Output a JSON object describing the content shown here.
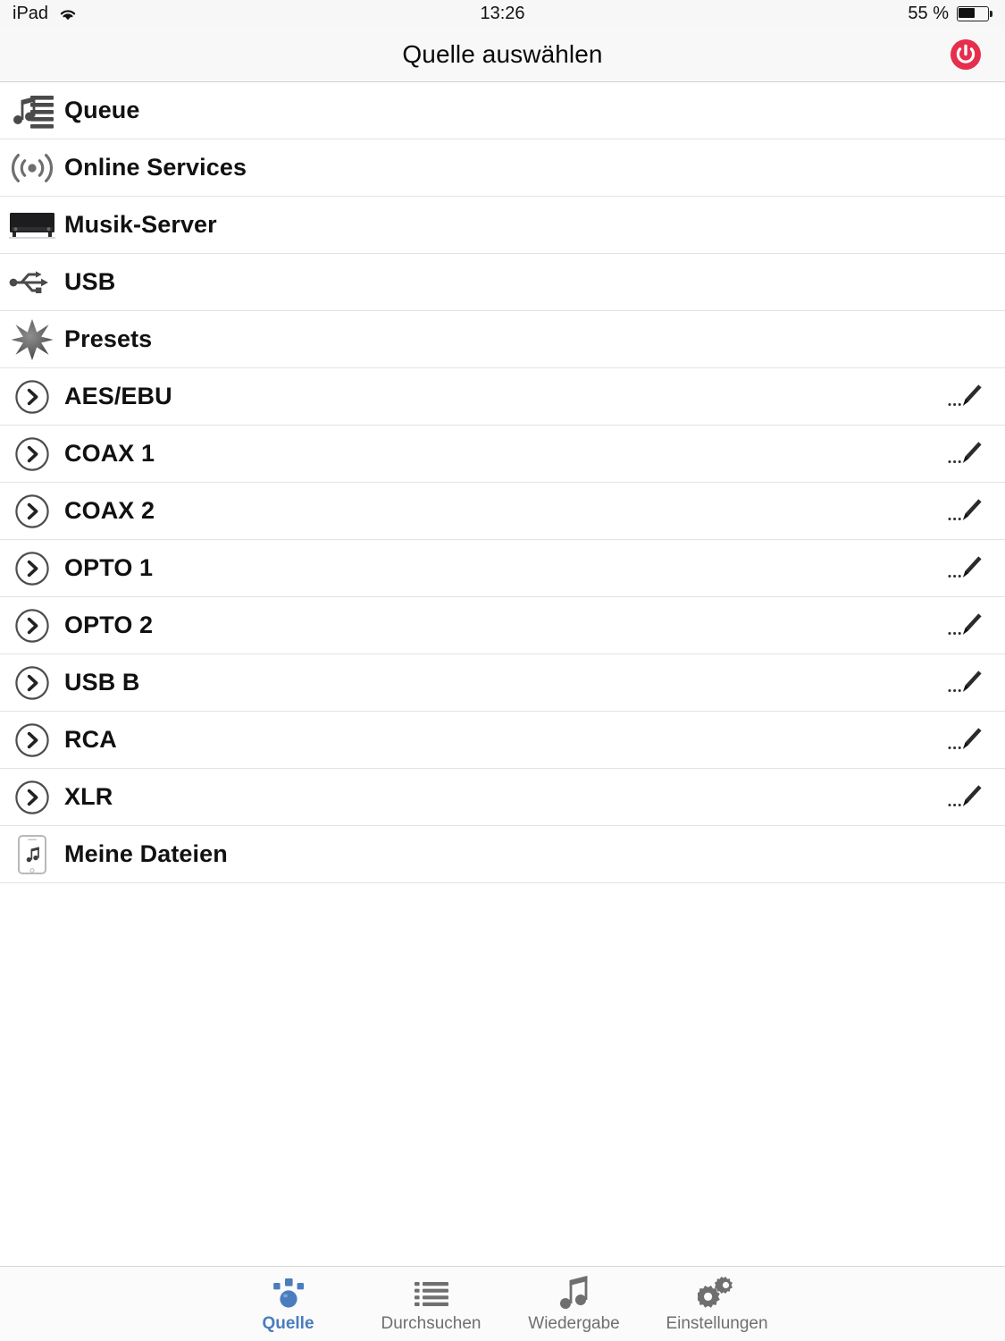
{
  "status_bar": {
    "device": "iPad",
    "wifi_icon": "wifi-icon",
    "time": "13:26",
    "battery_percent": "55 %",
    "battery_level": 55
  },
  "nav": {
    "title": "Quelle auswählen",
    "power_icon": "power-icon",
    "power_color": "#E62E4D"
  },
  "list": {
    "rows": [
      {
        "label": "Queue",
        "icon": "queue-music-list-icon",
        "editable": false
      },
      {
        "label": "Online Services",
        "icon": "broadcast-signal-icon",
        "editable": false
      },
      {
        "label": "Musik-Server",
        "icon": "av-component-icon",
        "editable": false
      },
      {
        "label": "USB",
        "icon": "usb-icon",
        "editable": false
      },
      {
        "label": "Presets",
        "icon": "star-burst-icon",
        "editable": false
      },
      {
        "label": "AES/EBU",
        "icon": "chevron-right-circle-icon",
        "editable": true,
        "edit_icon": "pencil-edit-icon"
      },
      {
        "label": "COAX 1",
        "icon": "chevron-right-circle-icon",
        "editable": true,
        "edit_icon": "pencil-edit-icon"
      },
      {
        "label": "COAX 2",
        "icon": "chevron-right-circle-icon",
        "editable": true,
        "edit_icon": "pencil-edit-icon"
      },
      {
        "label": "OPTO 1",
        "icon": "chevron-right-circle-icon",
        "editable": true,
        "edit_icon": "pencil-edit-icon"
      },
      {
        "label": "OPTO 2",
        "icon": "chevron-right-circle-icon",
        "editable": true,
        "edit_icon": "pencil-edit-icon"
      },
      {
        "label": "USB B",
        "icon": "chevron-right-circle-icon",
        "editable": true,
        "edit_icon": "pencil-edit-icon"
      },
      {
        "label": "RCA",
        "icon": "chevron-right-circle-icon",
        "editable": true,
        "edit_icon": "pencil-edit-icon"
      },
      {
        "label": "XLR",
        "icon": "chevron-right-circle-icon",
        "editable": true,
        "edit_icon": "pencil-edit-icon"
      },
      {
        "label": "Meine Dateien",
        "icon": "device-music-icon",
        "editable": false
      }
    ]
  },
  "tabbar": {
    "active_color": "#4A7CBE",
    "inactive_color": "#6F6F6F",
    "tabs": [
      {
        "label": "Quelle",
        "icon": "source-node-icon",
        "active": true
      },
      {
        "label": "Durchsuchen",
        "icon": "browse-list-icon",
        "active": false
      },
      {
        "label": "Wiedergabe",
        "icon": "music-note-icon",
        "active": false
      },
      {
        "label": "Einstellungen",
        "icon": "gears-icon",
        "active": false
      }
    ]
  }
}
